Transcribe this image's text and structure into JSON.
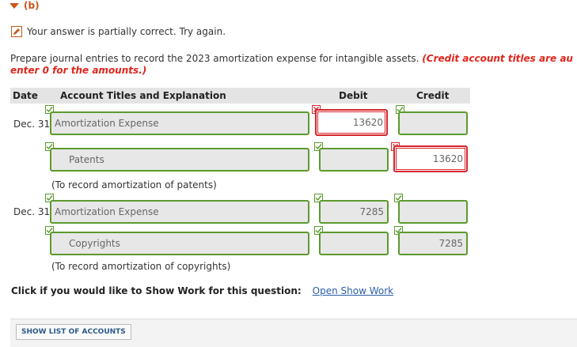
{
  "part": {
    "label": "(b)"
  },
  "status": {
    "text": "Your answer is partially correct.  Try again."
  },
  "prompt": {
    "line1_plain": "Prepare journal entries to record the 2023 amortization expense for intangible assets. ",
    "line1_red": "(Credit account titles are au",
    "line2_red": "enter 0 for the amounts.)"
  },
  "table": {
    "headers": {
      "date": "Date",
      "account": "Account Titles and Explanation",
      "debit": "Debit",
      "credit": "Credit"
    }
  },
  "entries": [
    {
      "date": "Dec. 31",
      "debit_account": "Amortization Expense",
      "debit_amount": "13620",
      "debit_amount_status": "incorrect",
      "credit_account": "Patents",
      "credit_amount": "13620",
      "credit_amount_status": "incorrect",
      "memo": "(To record amortization of patents)"
    },
    {
      "date": "Dec. 31",
      "debit_account": "Amortization Expense",
      "debit_amount": "7285",
      "debit_amount_status": "correct",
      "credit_account": "Copyrights",
      "credit_amount": "7285",
      "credit_amount_status": "correct",
      "memo": "(To record amortization of copyrights)"
    }
  ],
  "show_work": {
    "prompt": "Click if you would like to Show Work for this question:",
    "link": "Open Show Work"
  },
  "footer": {
    "button": "SHOW LIST OF ACCOUNTS"
  },
  "colors": {
    "accent": "#c8561b",
    "correct": "#5c9a2e",
    "incorrect": "#d7262c",
    "link": "#2b5fa8"
  }
}
